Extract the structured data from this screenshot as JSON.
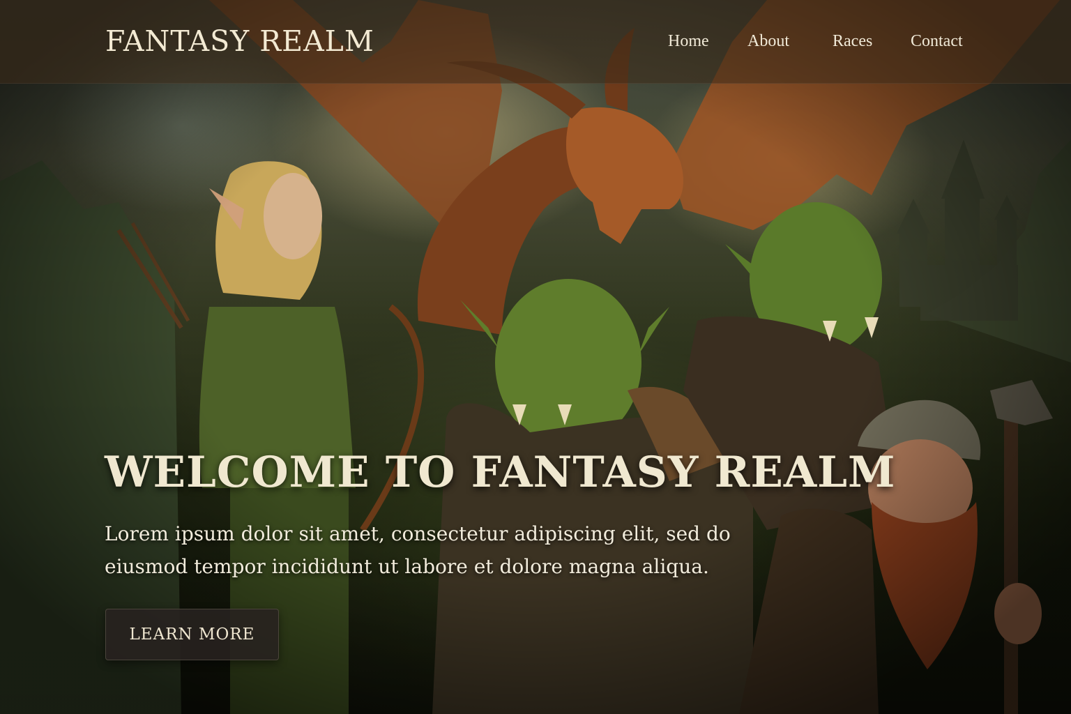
{
  "site": {
    "brand": "FANTASY REALM"
  },
  "nav": {
    "items": [
      {
        "label": "Home"
      },
      {
        "label": "About"
      },
      {
        "label": "Races"
      },
      {
        "label": "Contact"
      }
    ]
  },
  "hero": {
    "title": "WELCOME TO FANTASY REALM",
    "text": "Lorem ipsum dolor sit amet, consectetur adipiscing elit, sed do eiusmod tempor incididunt ut labore et dolore magna aliqua.",
    "cta_label": "LEARN MORE",
    "illustration_subjects": [
      "dragon",
      "elf-archer",
      "orc",
      "orc",
      "dwarf",
      "castle"
    ]
  },
  "colors": {
    "navbar_bg": "#3e2c1a",
    "text_light": "#f0e8d0",
    "button_bg": "#282220",
    "dragon": "#a8552a",
    "orc_skin": "#5f7d2c"
  }
}
